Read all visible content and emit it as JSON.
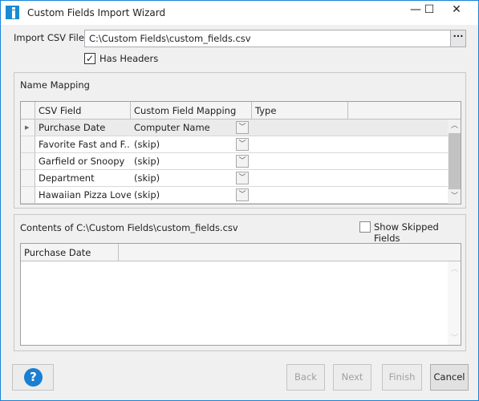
{
  "window": {
    "title": "Custom Fields Import Wizard",
    "minimize": "—",
    "maximize": "☐",
    "close": "✕"
  },
  "file": {
    "label": "Import CSV File",
    "value": "C:\\Custom Fields\\custom_fields.csv",
    "browse": "···"
  },
  "has_headers": {
    "label": "Has Headers",
    "checked": true,
    "mark": "✓"
  },
  "mapping": {
    "title": "Name Mapping",
    "columns": [
      "CSV Field",
      "Custom Field Mapping",
      "Type"
    ],
    "rows": [
      {
        "field": "Purchase Date",
        "mapping": "Computer Name",
        "type": ""
      },
      {
        "field": "Favorite Fast and F...",
        "mapping": "(skip)",
        "type": ""
      },
      {
        "field": "Garfield or Snoopy",
        "mapping": "(skip)",
        "type": ""
      },
      {
        "field": "Department",
        "mapping": "(skip)",
        "type": ""
      },
      {
        "field": "Hawaiian Pizza Lover",
        "mapping": "(skip)",
        "type": ""
      }
    ]
  },
  "contents": {
    "title": "Contents of C:\\Custom Fields\\custom_fields.csv",
    "show_skipped": "Show Skipped Fields",
    "show_skipped_checked": false,
    "columns": [
      "Purchase Date"
    ]
  },
  "buttons": {
    "help": "?",
    "back": "Back",
    "next": "Next",
    "finish": "Finish",
    "cancel": "Cancel"
  }
}
